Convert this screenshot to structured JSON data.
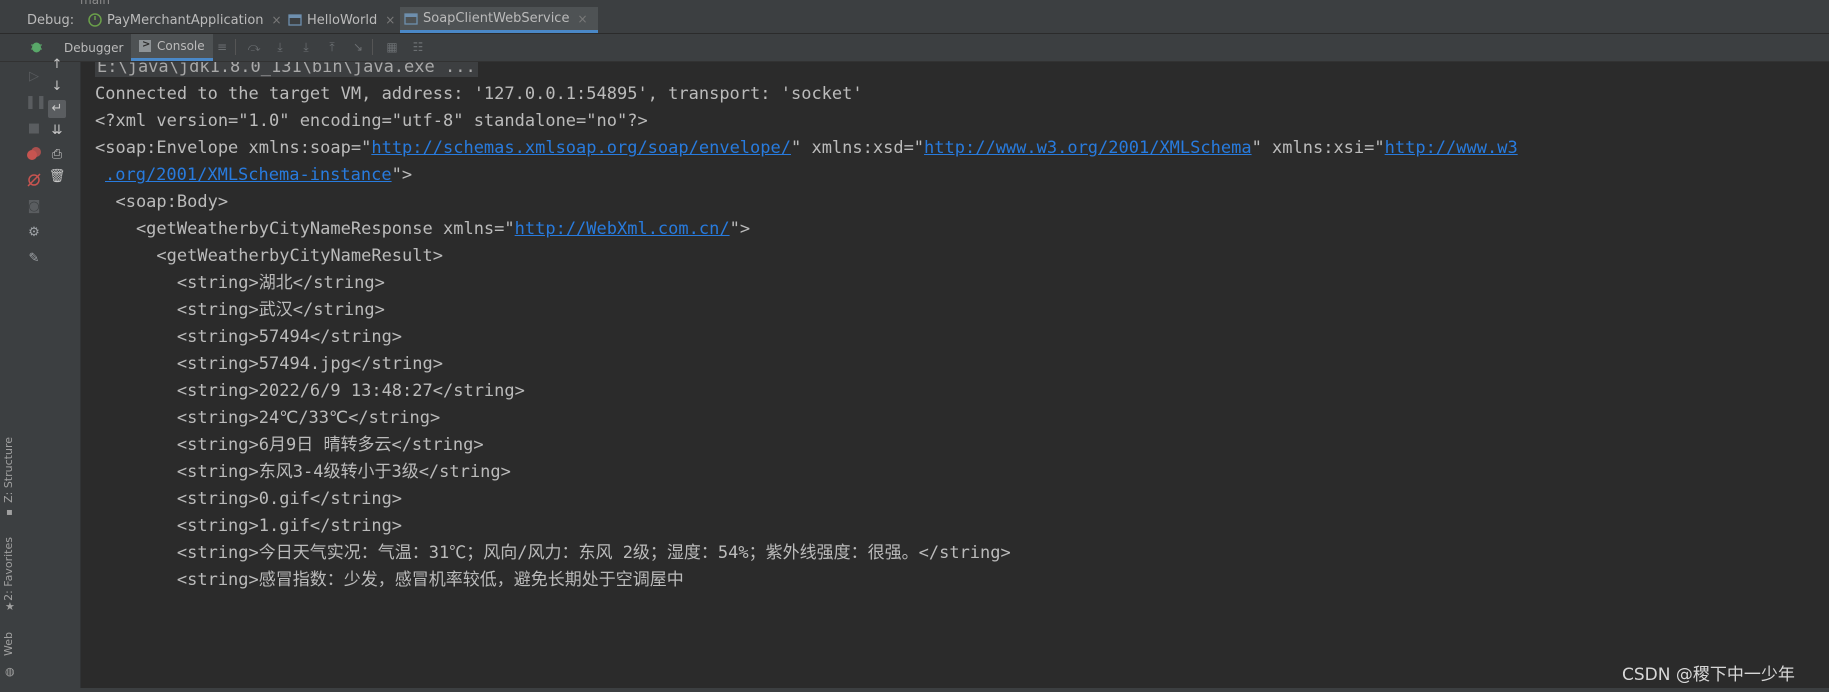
{
  "top": {
    "branch": "main"
  },
  "debug_bar": {
    "label": "Debug:",
    "tabs": [
      {
        "label": "PayMerchantApplication",
        "icon": "spring-boot-icon",
        "close": "×"
      },
      {
        "label": "HelloWorld",
        "icon": "application-icon",
        "close": "×"
      },
      {
        "label": "SoapClientWebService",
        "icon": "application-icon",
        "close": "×",
        "active": true
      }
    ]
  },
  "sub_bar": {
    "tabs": [
      {
        "label": "Debugger"
      },
      {
        "label": "Console",
        "active": true
      }
    ]
  },
  "left_strip": {
    "labels": [
      "Z: Structure",
      "2: Favorites",
      "Web"
    ]
  },
  "console": {
    "cmd": "E:\\java\\jdk1.8.0_131\\bin\\java.exe ...",
    "connected": "Connected to the target VM, address: '127.0.0.1:54895', transport: 'socket'",
    "xml_decl": "<?xml version=\"1.0\" encoding=\"utf-8\" standalone=\"no\"?>",
    "envelope": {
      "p1": "<soap:Envelope xmlns:soap=\"",
      "link1": "http://schemas.xmlsoap.org/soap/envelope/",
      "p2": "\" xmlns:xsd=\"",
      "link2": "http://www.w3.org/2001/XMLSchema",
      "p3": "\" xmlns:xsi=\"",
      "link3a": "http://www.w3",
      "link3b": ".org/2001/XMLSchema-instance",
      "p4": "\">"
    },
    "body": "  <soap:Body>",
    "response": {
      "p1": "    <getWeatherbyCityNameResponse xmlns=\"",
      "link": "http://WebXml.com.cn/",
      "p2": "\">"
    },
    "result": "      <getWeatherbyCityNameResult>",
    "strings": [
      "        <string>湖北</string>",
      "        <string>武汉</string>",
      "        <string>57494</string>",
      "        <string>57494.jpg</string>",
      "        <string>2022/6/9 13:48:27</string>",
      "        <string>24℃/33℃</string>",
      "        <string>6月9日 晴转多云</string>",
      "        <string>东风3-4级转小于3级</string>",
      "        <string>0.gif</string>",
      "        <string>1.gif</string>",
      "        <string>今日天气实况：气温：31℃；风向/风力：东风 2级；湿度：54%；紫外线强度：很强。</string>",
      "        <string>感冒指数：少发，感冒机率较低，避免长期处于空调屋中"
    ],
    "watermark": "CSDN @稷下中一少年"
  }
}
